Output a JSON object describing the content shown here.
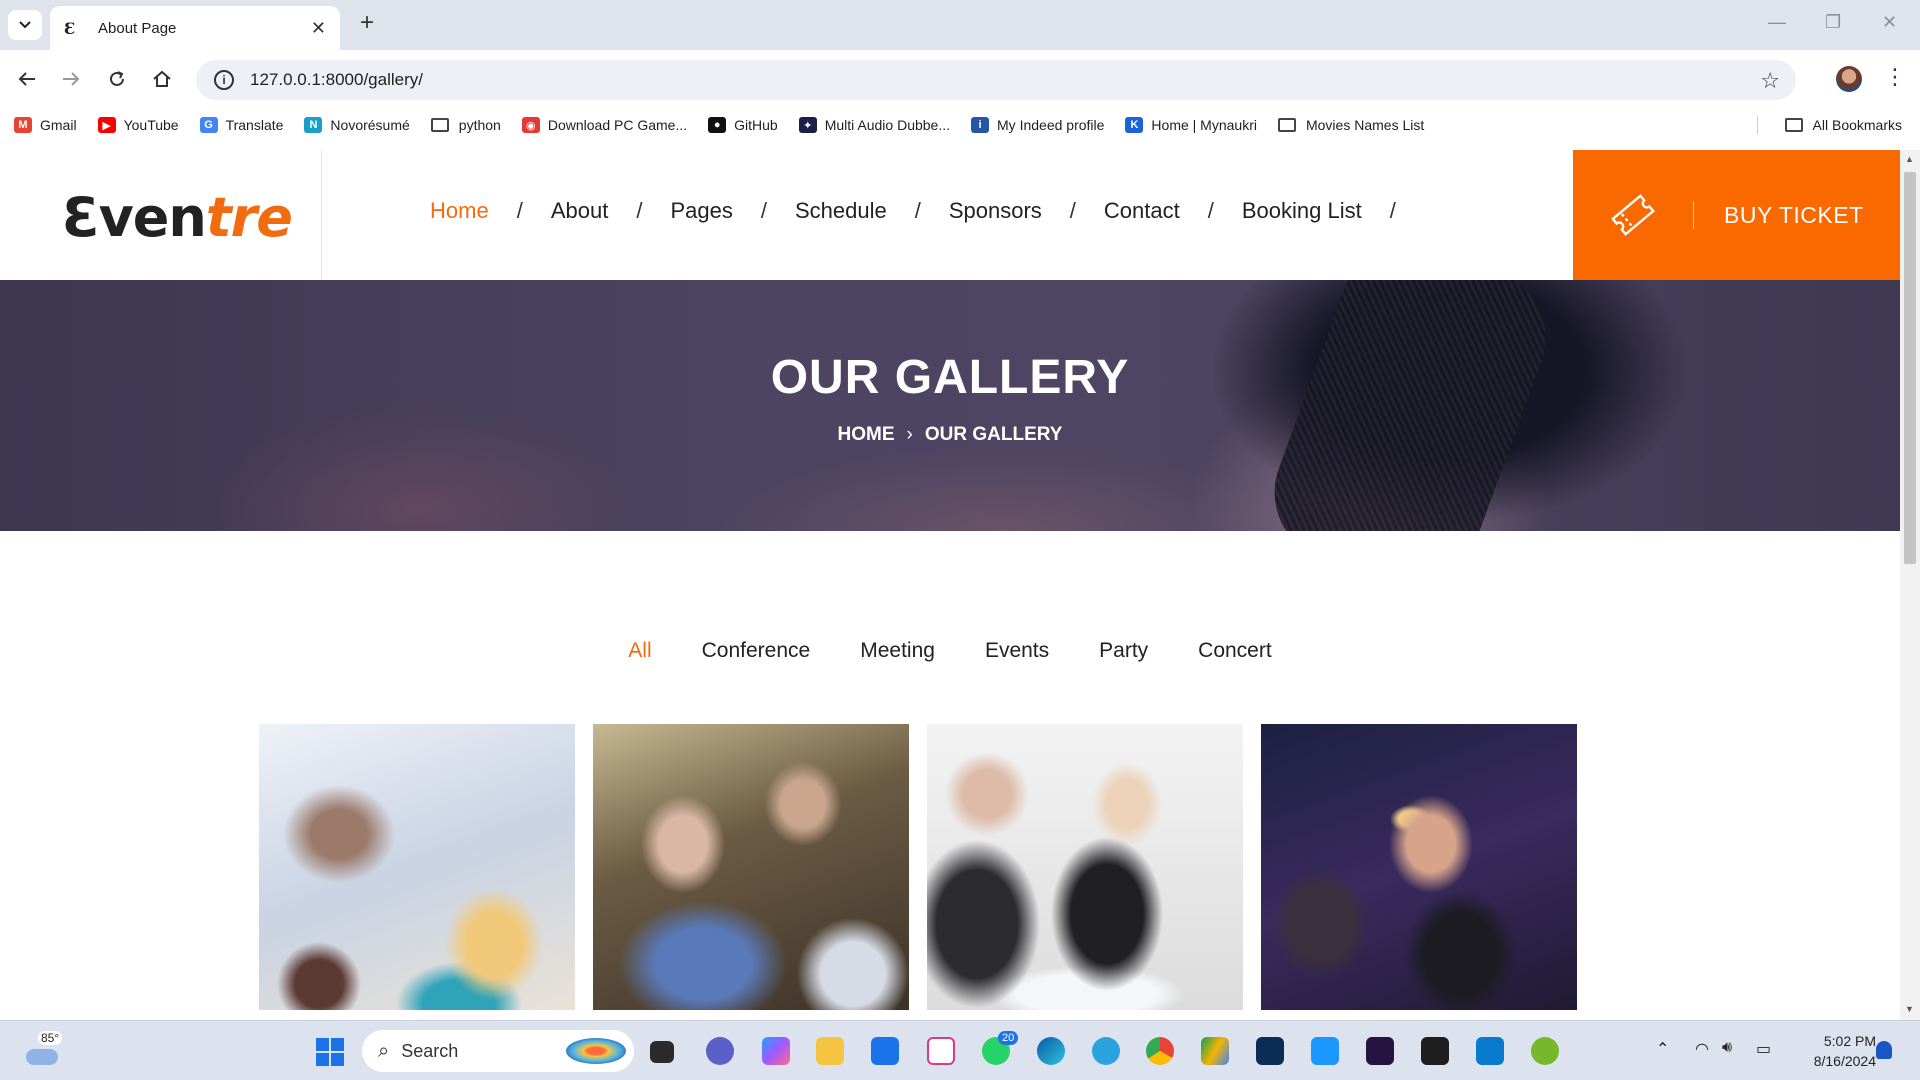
{
  "browser": {
    "tab_title": "About Page",
    "tab_favicon": "Ɛ",
    "new_tab": "+",
    "url": "127.0.0.1:8000/gallery/",
    "bookmarks": [
      {
        "label": "Gmail",
        "icon": "gmail-icon",
        "color": "#ea4335",
        "glyph": "M"
      },
      {
        "label": "YouTube",
        "icon": "youtube-icon",
        "color": "#ff0000",
        "glyph": "▶"
      },
      {
        "label": "Translate",
        "icon": "translate-icon",
        "color": "#4285f4",
        "glyph": "G"
      },
      {
        "label": "Novorésumé",
        "icon": "novoresume-icon",
        "color": "#1aa0c8",
        "glyph": "N"
      },
      {
        "label": "python",
        "icon": "folder-icon",
        "folder": true
      },
      {
        "label": "Download PC Game...",
        "icon": "ghost-icon",
        "color": "#e53935",
        "glyph": "◉"
      },
      {
        "label": "GitHub",
        "icon": "github-icon",
        "color": "#111111",
        "glyph": "●"
      },
      {
        "label": "Multi Audio Dubbe...",
        "icon": "dubbing-icon",
        "color": "#1b1f4a",
        "glyph": "✦"
      },
      {
        "label": "My Indeed profile",
        "icon": "indeed-icon",
        "color": "#2557a7",
        "glyph": "i"
      },
      {
        "label": "Home | Mynaukri",
        "icon": "naukri-icon",
        "color": "#1a63d8",
        "glyph": "K"
      },
      {
        "label": "Movies Names List",
        "icon": "folder-icon",
        "folder": true
      }
    ],
    "all_bookmarks": "All Bookmarks"
  },
  "site": {
    "logo_main": "Ɛven",
    "logo_accent": "tre",
    "nav": [
      "Home",
      "About",
      "Pages",
      "Schedule",
      "Sponsors",
      "Contact",
      "Booking List"
    ],
    "nav_active": "Home",
    "nav_sep": "/",
    "buy_ticket": "BUY TICKET",
    "accent_color": "#fa6800"
  },
  "hero": {
    "title": "OUR GALLERY",
    "crumb_home": "HOME",
    "crumb_sep": "›",
    "crumb_current": "OUR GALLERY"
  },
  "filters": [
    "All",
    "Conference",
    "Meeting",
    "Events",
    "Party",
    "Concert"
  ],
  "filters_active": "All",
  "taskbar": {
    "temperature": "85°",
    "search_placeholder": "Search",
    "whatsapp_badge": "20",
    "time": "5:02 PM",
    "date": "8/16/2024"
  }
}
